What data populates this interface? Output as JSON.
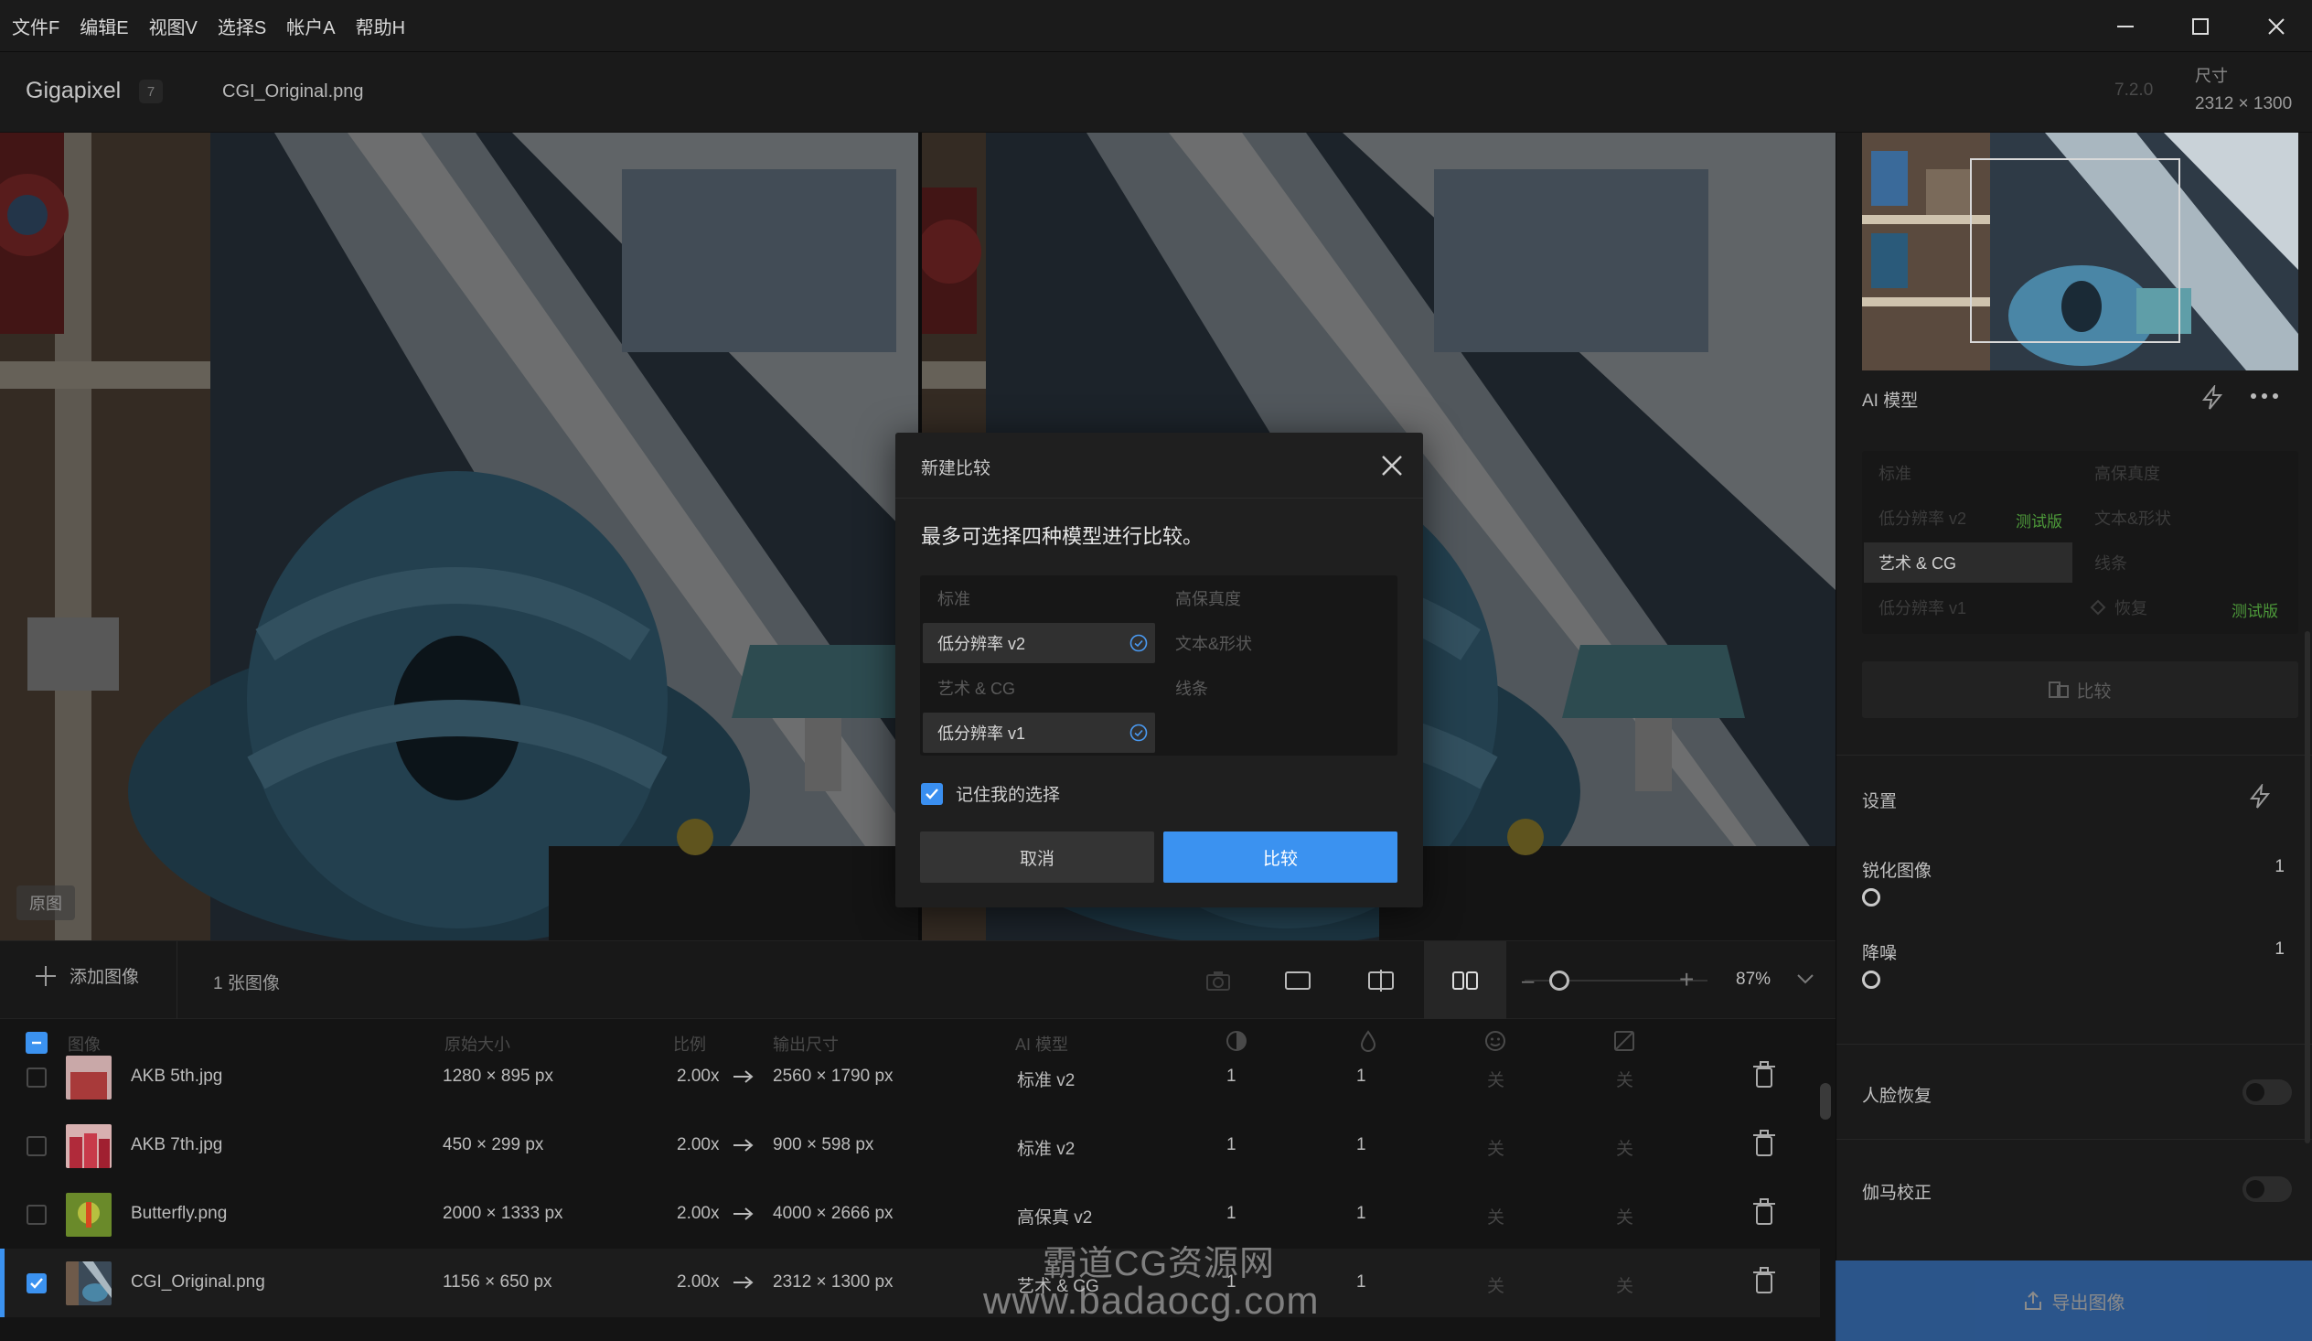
{
  "menubar": {
    "items": [
      "文件F",
      "编辑E",
      "视图V",
      "选择S",
      "帐户A",
      "帮助H"
    ]
  },
  "header": {
    "app_name": "Gigapixel",
    "app_badge": "7",
    "file_name": "CGI_Original.png",
    "version": "7.2.0",
    "size_label": "尺寸",
    "size_value": "2312 × 1300"
  },
  "preview": {
    "left_label": "原图"
  },
  "dialog": {
    "title": "新建比较",
    "subtitle": "最多可选择四种模型进行比较。",
    "models": {
      "standard": "标准",
      "low_res_v2": "低分辨率 v2",
      "art_cg": "艺术 & CG",
      "low_res_v1": "低分辨率 v1",
      "high_fidelity": "高保真度",
      "text_shape": "文本&形状",
      "lines": "线条"
    },
    "remember_label": "记住我的选择",
    "cancel_label": "取消",
    "compare_label": "比较"
  },
  "toolbar": {
    "add_label": "添加图像",
    "count_label": "1 张图像",
    "zoom_minus": "–",
    "zoom_plus": "+",
    "zoom_value": "87%"
  },
  "filelist": {
    "headers": {
      "image": "图像",
      "original_size": "原始大小",
      "scale": "比例",
      "output_size": "输出尺寸",
      "ai_model": "AI 模型"
    },
    "rows": [
      {
        "name": "AKB 5th.jpg",
        "orig": "1280 × 895 px",
        "scale": "2.00x",
        "out": "2560 × 1790 px",
        "model": "标准 v2",
        "v1": "1",
        "v2": "1",
        "v3": "关",
        "v4": "关"
      },
      {
        "name": "AKB 7th.jpg",
        "orig": "450 × 299 px",
        "scale": "2.00x",
        "out": "900 × 598 px",
        "model": "标准 v2",
        "v1": "1",
        "v2": "1",
        "v3": "关",
        "v4": "关"
      },
      {
        "name": "Butterfly.png",
        "orig": "2000 × 1333 px",
        "scale": "2.00x",
        "out": "4000 × 2666 px",
        "model": "高保真 v2",
        "v1": "1",
        "v2": "1",
        "v3": "关",
        "v4": "关"
      },
      {
        "name": "CGI_Original.png",
        "orig": "1156 × 650 px",
        "scale": "2.00x",
        "out": "2312 × 1300 px",
        "model": "艺术 & CG",
        "v1": "1",
        "v2": "1",
        "v3": "关",
        "v4": "关"
      }
    ]
  },
  "right_panel": {
    "ai_title": "AI 模型",
    "models": {
      "standard": "标准",
      "high_fidelity": "高保真度",
      "low_res_v2": "低分辨率 v2",
      "beta1": "测试版",
      "text_shape": "文本&形状",
      "art_cg": "艺术 & CG",
      "lines": "线条",
      "low_res_v1": "低分辨率 v1",
      "recover": "恢复",
      "beta2": "测试版"
    },
    "compare_label": "比较",
    "settings_title": "设置",
    "sharpen_label": "锐化图像",
    "sharpen_value": "1",
    "denoise_label": "降噪",
    "denoise_value": "1",
    "face_label": "人脸恢复",
    "gamma_label": "伽马校正",
    "export_label": "导出图像"
  },
  "watermark": {
    "line1": "霸道CG资源网",
    "line2": "www.badaocg.com"
  },
  "colors": {
    "accent": "#3b92f0",
    "beta": "#4d9a3a",
    "background": "#151515"
  }
}
